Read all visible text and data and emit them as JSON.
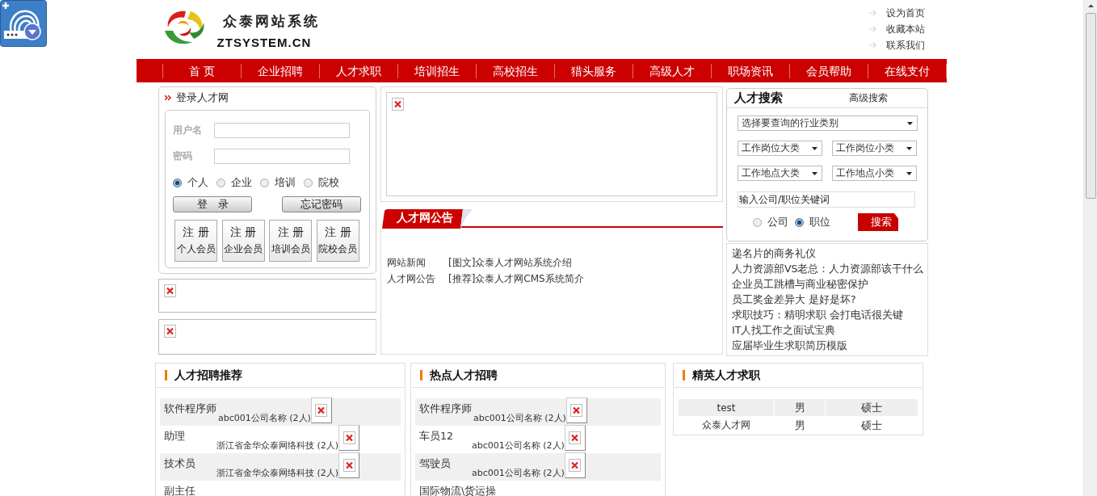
{
  "logo": {
    "title": "众泰网站系统",
    "subtitle": "ZTSYSTEM.CN"
  },
  "top_links": [
    "设为首页",
    "收藏本站",
    "联系我们"
  ],
  "nav": [
    "首 页",
    "企业招聘",
    "人才求职",
    "培训招生",
    "高校招生",
    "猎头服务",
    "高级人才",
    "职场资讯",
    "会员帮助",
    "在线支付"
  ],
  "login": {
    "title": "登录人才网",
    "fields": [
      {
        "label": "用户名"
      },
      {
        "label": "密码"
      }
    ],
    "roles": [
      {
        "label": "个人",
        "selected": true
      },
      {
        "label": "企业",
        "selected": false
      },
      {
        "label": "培训",
        "selected": false
      },
      {
        "label": "院校",
        "selected": false
      }
    ],
    "buttons": [
      "登　录",
      "忘记密码"
    ],
    "register": [
      {
        "action": "注 册",
        "type": "个人会员"
      },
      {
        "action": "注 册",
        "type": "企业会员"
      },
      {
        "action": "注 册",
        "type": "培训会员"
      },
      {
        "action": "注 册",
        "type": "院校会员"
      }
    ]
  },
  "left_banners": [
    {
      "kind": "broken_image"
    },
    {
      "kind": "broken_image"
    }
  ],
  "main_banner": {
    "kind": "broken_image"
  },
  "notice": {
    "title": "人才网公告",
    "items": [
      {
        "category": "网站新闻",
        "title": "[图文]众泰人才网站系统介绍"
      },
      {
        "category": "人才网公告",
        "title": "[推荐]众泰人才网CMS系统简介"
      }
    ]
  },
  "search": {
    "title": "人才搜索",
    "advanced_link": "高级搜索",
    "industry": "选择要查询的行业类别",
    "selects": [
      {
        "value": "工作岗位大类"
      },
      {
        "value": "工作岗位小类"
      },
      {
        "value": "工作地点大类"
      },
      {
        "value": "工作地点小类"
      }
    ],
    "keyword": "输入公司/职位关键词",
    "modes": [
      {
        "label": "公司",
        "selected": false
      },
      {
        "label": "职位",
        "selected": true
      }
    ],
    "button": "搜索"
  },
  "articles": [
    "递名片的商务礼仪",
    "人力资源部VS老总：人力资源部该干什么",
    "企业员工跳槽与商业秘密保护",
    "员工奖金差异大 是好是坏?",
    "求职技巧：精明求职 会打电话很关键",
    "IT人找工作之面试宝典",
    "应届毕业生求职简历模版"
  ],
  "recommended_jobs": {
    "title": "人才招聘推荐",
    "rows": [
      {
        "position": "软件程序师",
        "company": "abc001公司名称",
        "count": "(2人)"
      },
      {
        "position": "助理",
        "company": "浙江省金华众泰网络科技",
        "count": "(2人)"
      },
      {
        "position": "技术员",
        "company": "浙江省金华众泰网络科技",
        "count": "(2人)"
      },
      {
        "position": "副主任"
      }
    ]
  },
  "hot_jobs": {
    "title": "热点人才招聘",
    "rows": [
      {
        "position": "软件程序师",
        "company": "abc001公司名称",
        "count": "(2人)"
      },
      {
        "position": "车员12",
        "company": "abc001公司名称",
        "count": "(2人)"
      },
      {
        "position": "驾驶员",
        "company": "abc001公司名称",
        "count": "(2人)"
      },
      {
        "position": "国际物流\\货运操"
      }
    ]
  },
  "elite_talents": {
    "title": "精英人才求职",
    "rows": [
      {
        "name": "test",
        "gender": "男",
        "degree": "硕士"
      },
      {
        "name": "众泰人才网",
        "gender": "男",
        "degree": "硕士"
      }
    ]
  }
}
